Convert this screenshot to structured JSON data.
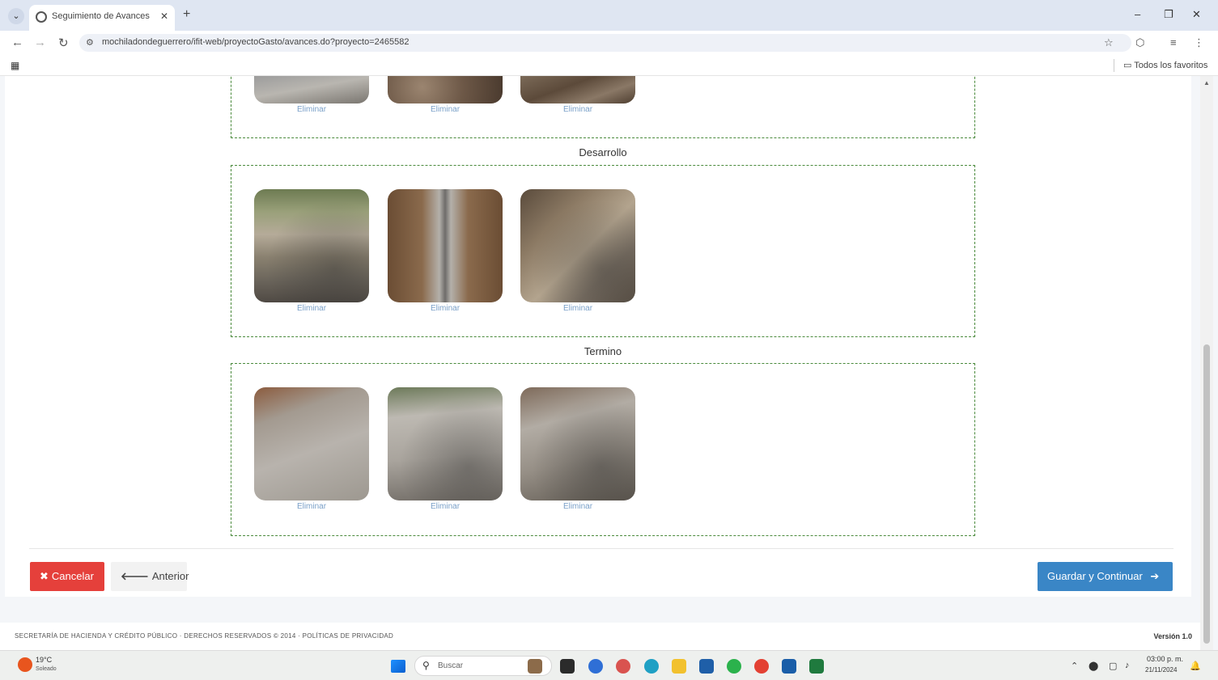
{
  "browser": {
    "tab_title": "Seguimiento de Avances",
    "new_tab": "+",
    "url": "mochiladondeguerrero/ifit-web/proyectoGasto/avances.do?proyecto=2465582",
    "all_bookmarks": "Todos los favoritos",
    "win_min": "–",
    "win_restore": "❐",
    "win_close": "✕"
  },
  "sections": [
    {
      "label": "",
      "delete_labels": [
        "Eliminar",
        "Eliminar",
        "Eliminar"
      ]
    },
    {
      "label": "Desarrollo",
      "delete_labels": [
        "Eliminar",
        "Eliminar",
        "Eliminar"
      ]
    },
    {
      "label": "Termino",
      "delete_labels": [
        "Eliminar",
        "Eliminar",
        "Eliminar"
      ]
    }
  ],
  "actions": {
    "cancel_icon": "✖",
    "cancel": "Cancelar",
    "prev_icon": "🡐",
    "prev": "Anterior",
    "save": "Guardar y Continuar",
    "save_icon": "➔"
  },
  "footer": {
    "text": "SECRETARÍA DE HACIENDA Y CRÉDITO PÚBLICO · DERECHOS RESERVADOS © 2014 · POLÍTICAS DE PRIVACIDAD",
    "version": "Versión 1.0"
  },
  "taskbar": {
    "weather_temp": "19°C",
    "weather_desc": "Soleado",
    "search_placeholder": "Buscar",
    "time": "03:00 p. m.",
    "date": "21/11/2024"
  },
  "colors": {
    "cancel": "#e5403b",
    "save": "#3a86c6",
    "section_border": "#4a8a3c"
  }
}
